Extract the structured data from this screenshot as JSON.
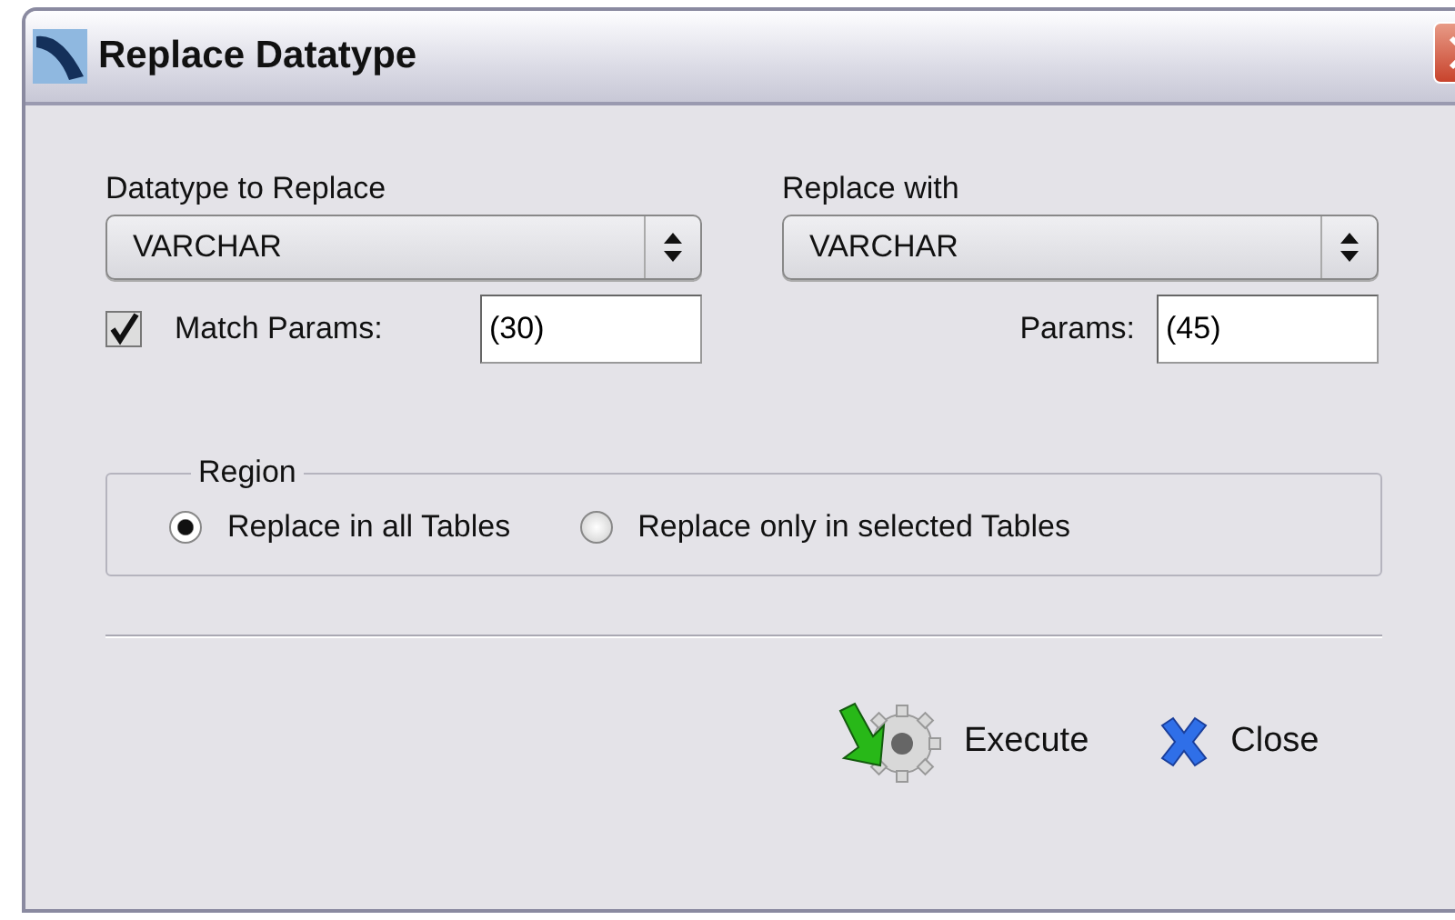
{
  "window": {
    "title": "Replace Datatype"
  },
  "source": {
    "label": "Datatype to Replace",
    "value": "VARCHAR",
    "match_params": {
      "label": "Match Params:",
      "checked": true
    },
    "params": "(30)"
  },
  "target": {
    "label": "Replace with",
    "value": "VARCHAR",
    "params_label": "Params:",
    "params": "(45)"
  },
  "region": {
    "legend": "Region",
    "options": [
      {
        "label": "Replace in all Tables",
        "selected": true
      },
      {
        "label": "Replace only in selected Tables",
        "selected": false
      }
    ]
  },
  "buttons": [
    {
      "kind": "execute",
      "label": "Execute"
    },
    {
      "kind": "close",
      "label": "Close"
    }
  ]
}
